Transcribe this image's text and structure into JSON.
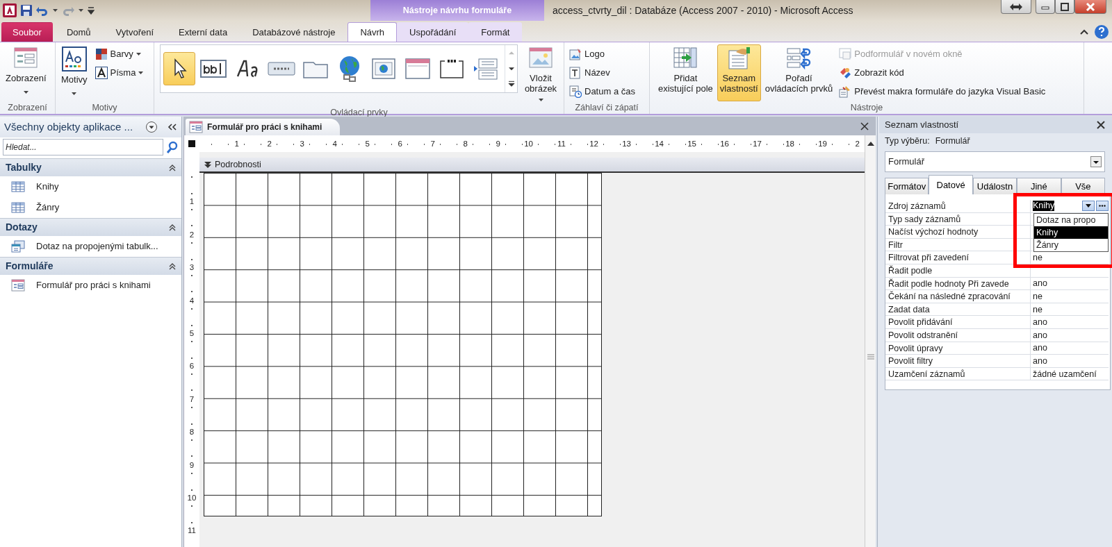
{
  "window": {
    "title": "access_ctvrty_dil : Databáze (Access 2007 - 2010)  -  Microsoft Access",
    "contextual_group": "Nástroje návrhu formuláře"
  },
  "ribbon_tabs": [
    {
      "label": "Soubor",
      "kind": "file",
      "selected": false,
      "contextual": false
    },
    {
      "label": "Domů",
      "kind": "tab",
      "selected": false,
      "contextual": false
    },
    {
      "label": "Vytvoření",
      "kind": "tab",
      "selected": false,
      "contextual": false
    },
    {
      "label": "Externí data",
      "kind": "tab",
      "selected": false,
      "contextual": false
    },
    {
      "label": "Databázové nástroje",
      "kind": "tab",
      "selected": false,
      "contextual": false
    },
    {
      "label": "Návrh",
      "kind": "tab",
      "selected": true,
      "contextual": true
    },
    {
      "label": "Uspořádání",
      "kind": "tab",
      "selected": false,
      "contextual": true
    },
    {
      "label": "Formát",
      "kind": "tab",
      "selected": false,
      "contextual": true
    }
  ],
  "ribbon_groups": [
    {
      "label": "Zobrazení",
      "buttons": [
        {
          "kind": "large",
          "label": [
            "Zobrazení"
          ],
          "dropdown": true,
          "selected": false,
          "disabled": false
        }
      ]
    },
    {
      "label": "Motivy",
      "buttons": [
        {
          "kind": "large",
          "label": [
            "Motivy"
          ],
          "dropdown": true,
          "selected": false,
          "disabled": false
        },
        {
          "kind": "small",
          "label": "Barvy",
          "dropdown": true,
          "selected": false,
          "disabled": false
        },
        {
          "kind": "small",
          "label": "Písma",
          "dropdown": true,
          "selected": false,
          "disabled": false
        }
      ]
    },
    {
      "label": "Ovládací prvky",
      "buttons": [
        {
          "kind": "gallery",
          "items": [
            {
              "selected": true
            },
            {
              "selected": false
            },
            {
              "selected": false
            },
            {
              "selected": false
            },
            {
              "selected": false
            },
            {
              "selected": false
            },
            {
              "selected": false
            },
            {
              "selected": false
            },
            {
              "selected": false
            },
            {
              "selected": false
            }
          ]
        },
        {
          "kind": "large",
          "label": [
            "Vložit",
            "obrázek"
          ],
          "dropdown": true,
          "selected": false,
          "disabled": false
        }
      ]
    },
    {
      "label": "Záhlaví či zápatí",
      "buttons": [
        {
          "kind": "small",
          "label": "Logo",
          "dropdown": false,
          "selected": false,
          "disabled": false
        },
        {
          "kind": "small",
          "label": "Název",
          "dropdown": false,
          "selected": false,
          "disabled": false
        },
        {
          "kind": "small",
          "label": "Datum a čas",
          "dropdown": false,
          "selected": false,
          "disabled": false
        }
      ]
    },
    {
      "label": "Nástroje",
      "buttons": [
        {
          "kind": "large",
          "label": [
            "Přidat",
            "existující pole"
          ],
          "dropdown": false,
          "selected": false,
          "disabled": false
        },
        {
          "kind": "large",
          "label": [
            "Seznam",
            "vlastností"
          ],
          "dropdown": false,
          "selected": true,
          "disabled": false
        },
        {
          "kind": "large",
          "label": [
            "Pořadí",
            "ovládacích prvků"
          ],
          "dropdown": false,
          "selected": false,
          "disabled": false
        },
        {
          "kind": "small",
          "label": "Podformulář v novém okně",
          "dropdown": false,
          "selected": false,
          "disabled": true
        },
        {
          "kind": "small",
          "label": "Zobrazit kód",
          "dropdown": false,
          "selected": false,
          "disabled": false
        },
        {
          "kind": "small",
          "label": "Převést makra formuláře do jazyka Visual Basic",
          "dropdown": false,
          "selected": false,
          "disabled": false
        }
      ]
    }
  ],
  "navigation_pane": {
    "title": "Všechny objekty aplikace ...",
    "search": {
      "placeholder": "Hledat..."
    },
    "groups": [
      {
        "label": "Tabulky",
        "kind": "table",
        "items": [
          "Knihy",
          "Žánry"
        ]
      },
      {
        "label": "Dotazy",
        "kind": "query",
        "items": [
          "Dotaz na propojenými tabulk..."
        ]
      },
      {
        "label": "Formuláře",
        "kind": "form",
        "items": [
          "Formulář pro práci s knihami"
        ]
      }
    ]
  },
  "document": {
    "tab": "Formulář pro práci s knihami",
    "section": "Podrobnosti",
    "ruler": {
      "horizontal": [
        "1",
        "2",
        "3",
        "4",
        "5",
        "6",
        "7",
        "8",
        "9",
        "10",
        "11",
        "12",
        "13",
        "14",
        "15",
        "16",
        "17",
        "18",
        "19",
        "2"
      ],
      "vertical": [
        "1",
        "2",
        "3",
        "4",
        "5",
        "6",
        "7",
        "8",
        "9",
        "10",
        "11"
      ]
    }
  },
  "property_sheet": {
    "title": "Seznam vlastností",
    "selection_type_label": "Typ výběru:",
    "selection_type": "Formulář",
    "object": "Formulář",
    "tabs": [
      {
        "label": "Formátov",
        "selected": false
      },
      {
        "label": "Datové",
        "selected": true
      },
      {
        "label": "Událostn",
        "selected": false
      },
      {
        "label": "Jiné",
        "selected": false
      },
      {
        "label": "Vše",
        "selected": false
      }
    ],
    "rows": [
      {
        "name": "Zdroj záznamů",
        "kind": "combo",
        "value": "Knihy",
        "text_selected": true,
        "open": true,
        "options": [
          {
            "label": "Dotaz na propo",
            "selected": false
          },
          {
            "label": "Knihy",
            "selected": true
          },
          {
            "label": "Žánry",
            "selected": false
          }
        ]
      },
      {
        "name": "Typ sady záznamů",
        "kind": "text"
      },
      {
        "name": "Načíst výchozí hodnoty",
        "kind": "text"
      },
      {
        "name": "Filtr",
        "kind": "text"
      },
      {
        "name": "Filtrovat při zavedení",
        "kind": "text",
        "value": "ne"
      },
      {
        "name": "Řadit podle",
        "kind": "text"
      },
      {
        "name": "Řadit podle hodnoty Při zavede",
        "kind": "text",
        "value": "ano"
      },
      {
        "name": "Čekání na následné zpracování",
        "kind": "text",
        "value": "ne"
      },
      {
        "name": "Zadat data",
        "kind": "text",
        "value": "ne"
      },
      {
        "name": "Povolit přidávání",
        "kind": "text",
        "value": "ano"
      },
      {
        "name": "Povolit odstranění",
        "kind": "text",
        "value": "ano"
      },
      {
        "name": "Povolit úpravy",
        "kind": "text",
        "value": "ano"
      },
      {
        "name": "Povolit filtry",
        "kind": "text",
        "value": "ano"
      },
      {
        "name": "Uzamčení záznamů",
        "kind": "text",
        "value": "žádné uzamčení"
      }
    ],
    "annotation": {
      "kind": "frame"
    }
  }
}
